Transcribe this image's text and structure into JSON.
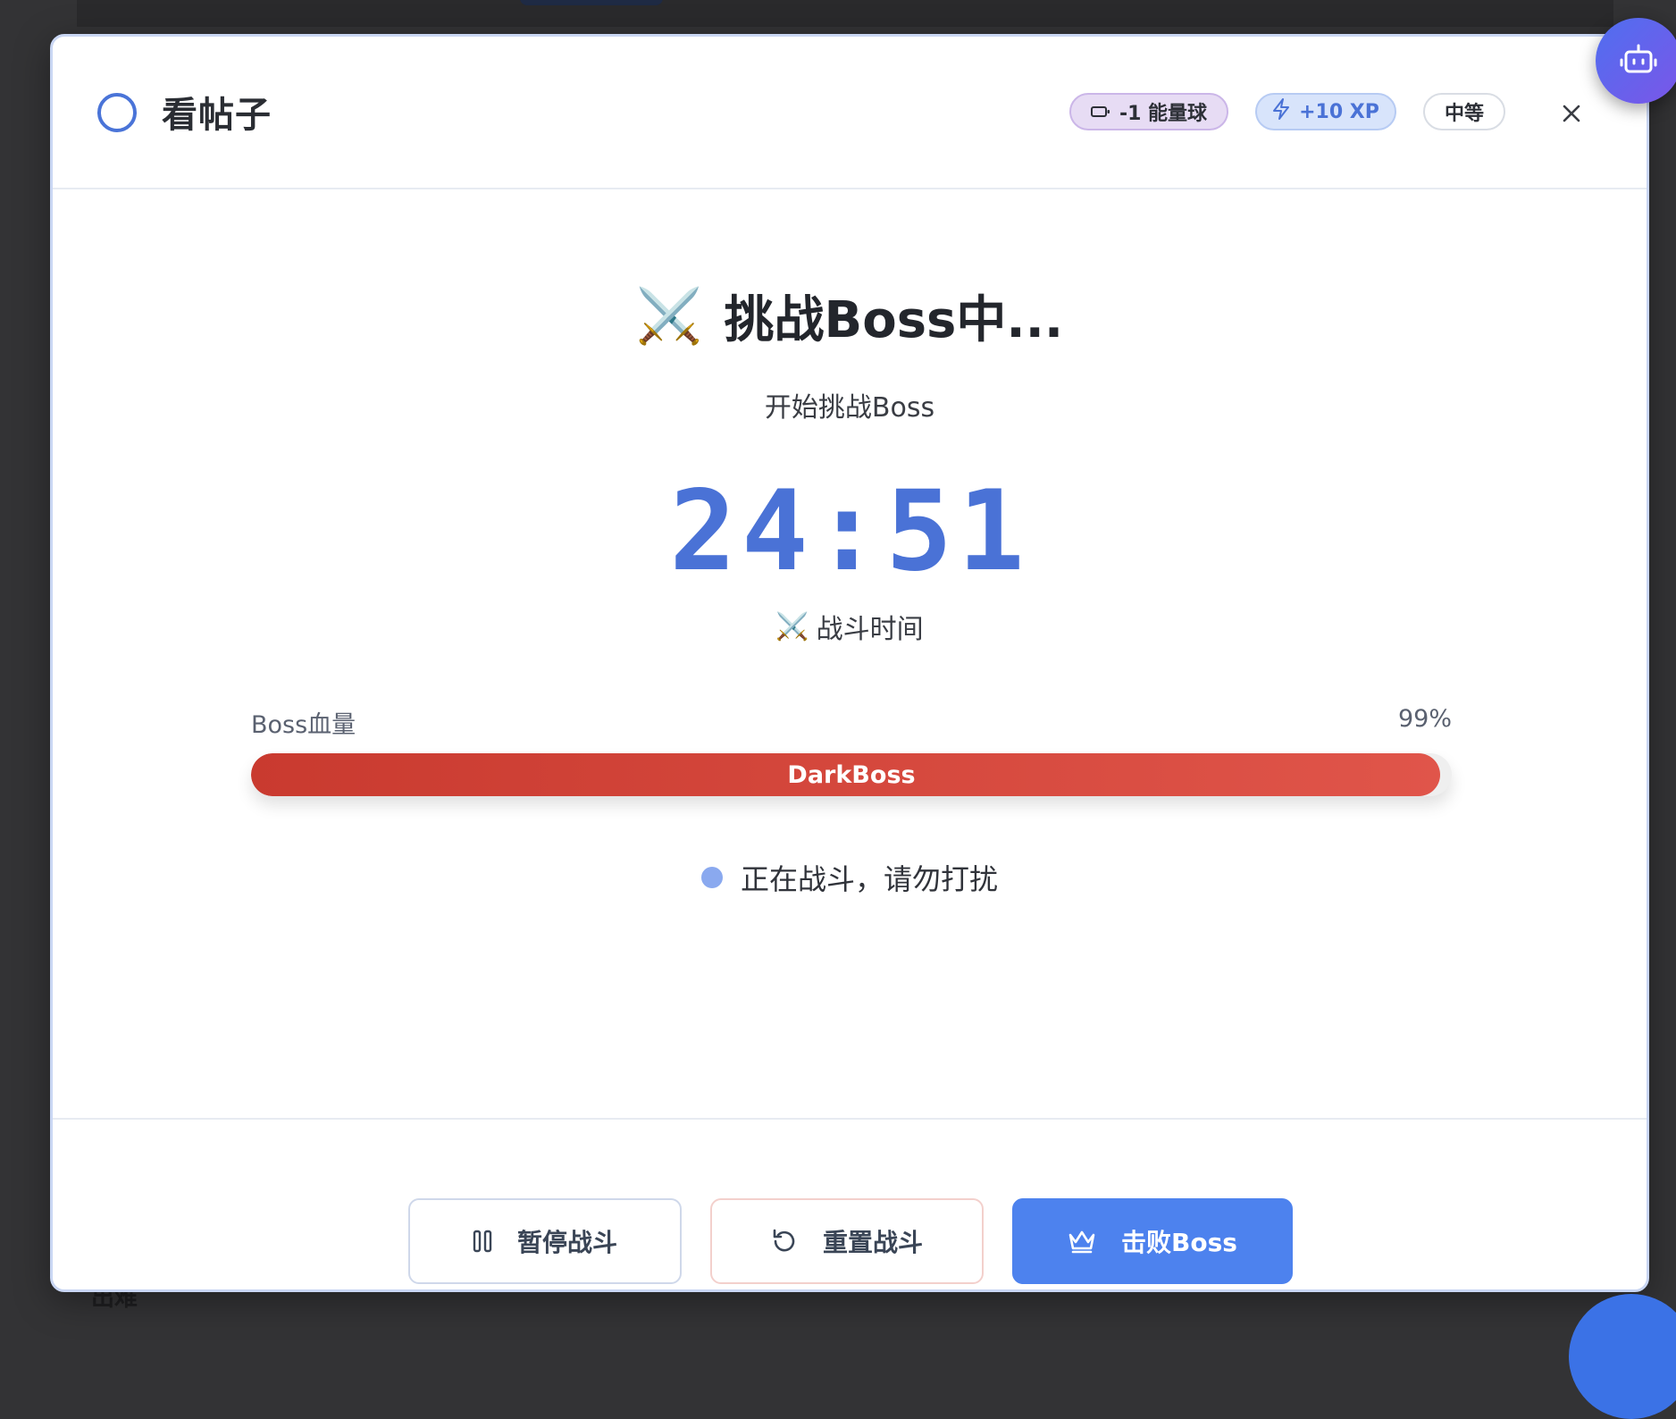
{
  "background": {
    "partial_text": "出难"
  },
  "task": {
    "title": "看帖子"
  },
  "badges": {
    "energy": "-1 能量球",
    "xp": "+10 XP",
    "level": "中等"
  },
  "battle": {
    "heading_icon": "⚔️",
    "heading": "挑战Boss中...",
    "subtitle": "开始挑战Boss",
    "timer": "24:51",
    "timer_label_icon": "⚔️",
    "timer_label": "战斗时间",
    "hp_label": "Boss血量",
    "hp_percent_text": "99%",
    "hp_fraction": 0.99,
    "boss_name": "DarkBoss",
    "status": "正在战斗，请勿打扰"
  },
  "footer": {
    "pause_label": "暂停战斗",
    "reset_label": "重置战斗",
    "defeat_label": "击败Boss"
  },
  "colors": {
    "accent": "#4a72d6",
    "primary_button": "#4d82ee",
    "hp_bar_start": "#c93a2f",
    "hp_bar_end": "#e0554a",
    "energy_badge": "#e7dcf4",
    "xp_badge": "#d8e4fb"
  },
  "icons": {
    "status": "circle-outline-icon",
    "energy": "battery-icon",
    "xp": "lightning-icon",
    "close": "close-icon",
    "pause": "pause-icon",
    "reset": "rotate-ccw-icon",
    "defeat": "crown-icon",
    "assistant": "robot-icon"
  }
}
